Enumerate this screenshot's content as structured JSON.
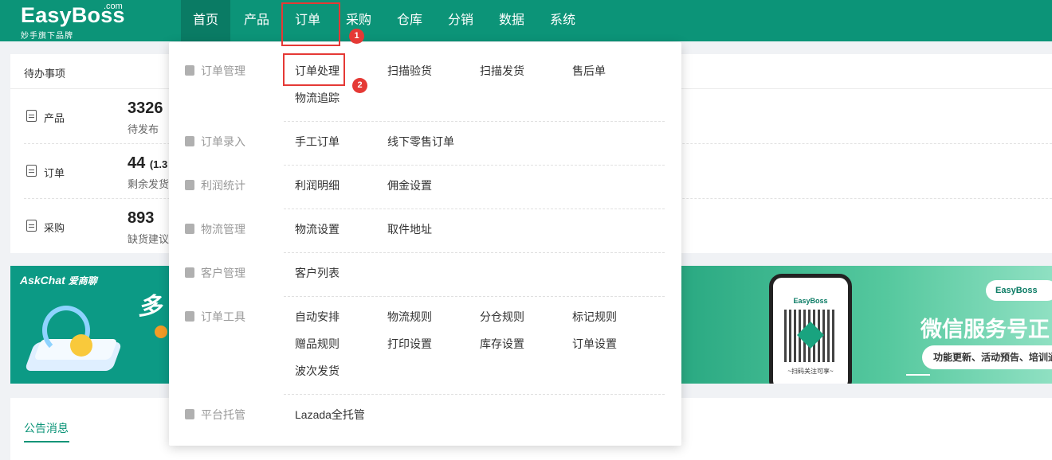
{
  "header": {
    "logo_main": "EasyBoss",
    "logo_com": ".com",
    "logo_sub": "妙手旗下品牌",
    "nav": [
      {
        "label": "首页"
      },
      {
        "label": "产品"
      },
      {
        "label": "订单"
      },
      {
        "label": "采购"
      },
      {
        "label": "仓库"
      },
      {
        "label": "分销"
      },
      {
        "label": "数据"
      },
      {
        "label": "系统"
      }
    ],
    "colors": {
      "brand": "#0c9478",
      "active": "#0a7b64",
      "highlight": "#e53935"
    }
  },
  "steps": [
    "1",
    "2"
  ],
  "todo": {
    "title": "待办事项",
    "rows": [
      {
        "label": "产品",
        "icon": "product-list-icon",
        "value": "3326",
        "value_sub": "",
        "sub": "待发布"
      },
      {
        "label": "订单",
        "icon": "order-clipboard-icon",
        "value": "44",
        "value_sub": "(1.3",
        "sub": "剩余发货"
      },
      {
        "label": "采购",
        "icon": "purchase-doc-icon",
        "value": "893",
        "value_sub": "",
        "sub": "缺货建议"
      }
    ]
  },
  "banner_left": {
    "brand": "AskChat",
    "brand_cn": "爱商聊",
    "partial_text": "多"
  },
  "banner_right": {
    "phone_brand": "EasyBoss",
    "phone_caption": "~扫码关注可享~",
    "badge": "EasyBoss",
    "title": "微信服务号正",
    "pill": "功能更新、活动预告、培训通"
  },
  "notice": {
    "title": "公告消息"
  },
  "dropdown": {
    "categories": [
      {
        "label": "订单管理",
        "icon": "order-manage-icon",
        "items": [
          "订单处理",
          "扫描验货",
          "扫描发货",
          "售后单",
          "物流追踪"
        ]
      },
      {
        "label": "订单录入",
        "icon": "order-entry-icon",
        "items": [
          "手工订单",
          "线下零售订单"
        ]
      },
      {
        "label": "利润统计",
        "icon": "profit-stats-icon",
        "items": [
          "利润明细",
          "佣金设置"
        ]
      },
      {
        "label": "物流管理",
        "icon": "logistics-truck-icon",
        "items": [
          "物流设置",
          "取件地址"
        ]
      },
      {
        "label": "客户管理",
        "icon": "customer-icon",
        "items": [
          "客户列表"
        ]
      },
      {
        "label": "订单工具",
        "icon": "order-tools-icon",
        "items": [
          "自动安排",
          "物流规则",
          "分仓规则",
          "标记规则",
          "赠品规则",
          "打印设置",
          "库存设置",
          "订单设置",
          "波次发货"
        ]
      },
      {
        "label": "平台托管",
        "icon": "platform-hosting-icon",
        "items": [
          "Lazada全托管"
        ]
      }
    ]
  }
}
